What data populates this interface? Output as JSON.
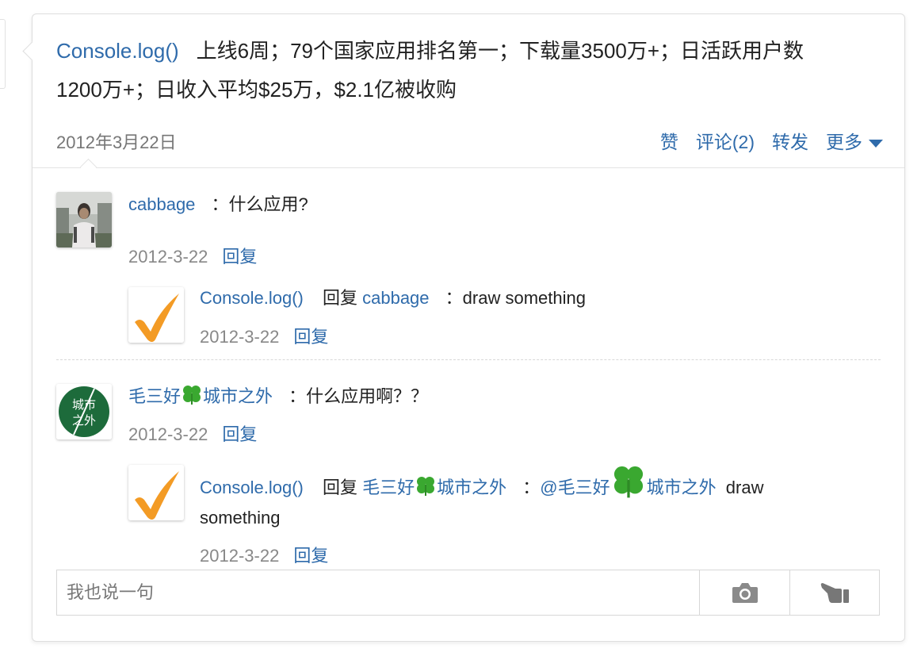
{
  "post": {
    "author": "Console.log()",
    "text_line1": "上线6周；79个国家应用排名第一；下载量3500万+；日活跃用户数",
    "text_line2": "1200万+；日收入平均$25万，$2.1亿被收购",
    "date": "2012年3月22日"
  },
  "actions": {
    "like": "赞",
    "comment": "评论(2)",
    "forward": "转发",
    "more": "更多"
  },
  "comments": [
    {
      "name": "cabbage",
      "text": "：什么应用?",
      "date": "2012-3-22",
      "reply_label": "回复",
      "reply": {
        "name": "Console.log()",
        "reply_word": "回复",
        "target": "cabbage",
        "text": "：draw something",
        "date": "2012-3-22",
        "reply_label": "回复"
      }
    },
    {
      "name_part1": "毛三好",
      "name_part2": "城市之外",
      "text": "：什么应用啊？？",
      "date": "2012-3-22",
      "reply_label": "回复",
      "avatar_text_top": "城市",
      "avatar_text_bottom": "之外",
      "reply": {
        "name": "Console.log()",
        "reply_word": "回复",
        "target_part1": "毛三好",
        "target_part2": "城市之外",
        "colon": "：",
        "mention_part1": "@毛三好",
        "mention_part2": "城市之外",
        "text_tail": "draw",
        "text_line2": "something",
        "date": "2012-3-22",
        "reply_label": "回复"
      }
    }
  ],
  "composer": {
    "placeholder": "我也说一句"
  },
  "icons": {
    "camera": "camera-icon",
    "pointer": "pointing-hand-icon",
    "clover": "clover-icon",
    "check": "checkmark-icon"
  },
  "colors": {
    "link": "#2f6bab",
    "check": "#f39b25",
    "clover": "#3aa830",
    "avatar_green": "#1d6b3b"
  }
}
